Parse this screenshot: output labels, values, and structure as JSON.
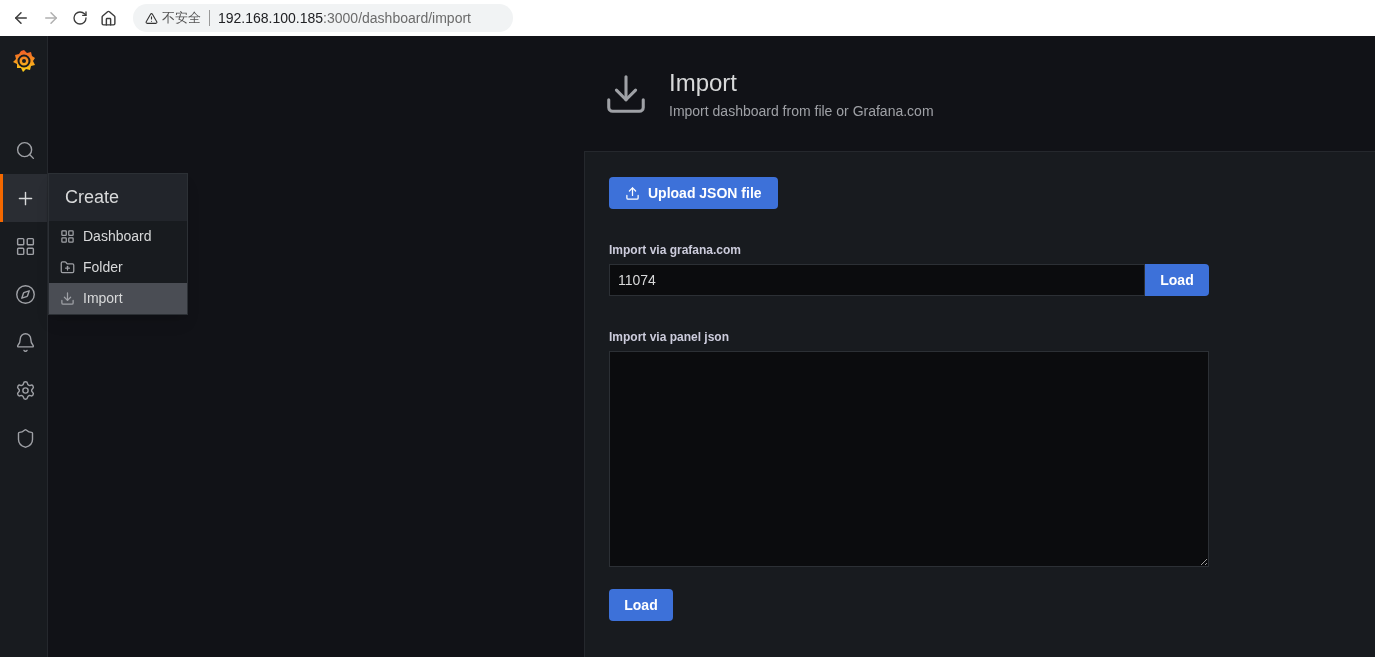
{
  "browser": {
    "security_label": "不安全",
    "url_host": "192.168.100.185",
    "url_path": ":3000/dashboard/import"
  },
  "sidebar": {
    "items": [
      {
        "selected": false
      },
      {
        "selected": true
      },
      {
        "selected": false
      },
      {
        "selected": false
      },
      {
        "selected": false
      },
      {
        "selected": false
      },
      {
        "selected": false
      }
    ]
  },
  "create_menu": {
    "title": "Create",
    "items": [
      {
        "label": "Dashboard",
        "selected": false
      },
      {
        "label": "Folder",
        "selected": false
      },
      {
        "label": "Import",
        "selected": true
      }
    ]
  },
  "page_header": {
    "title": "Import",
    "subtitle": "Import dashboard from file or Grafana.com"
  },
  "upload_button": "Upload JSON file",
  "grafana_com": {
    "label": "Import via grafana.com",
    "value": "11074",
    "button": "Load"
  },
  "panel_json": {
    "label": "Import via panel json",
    "button": "Load"
  }
}
